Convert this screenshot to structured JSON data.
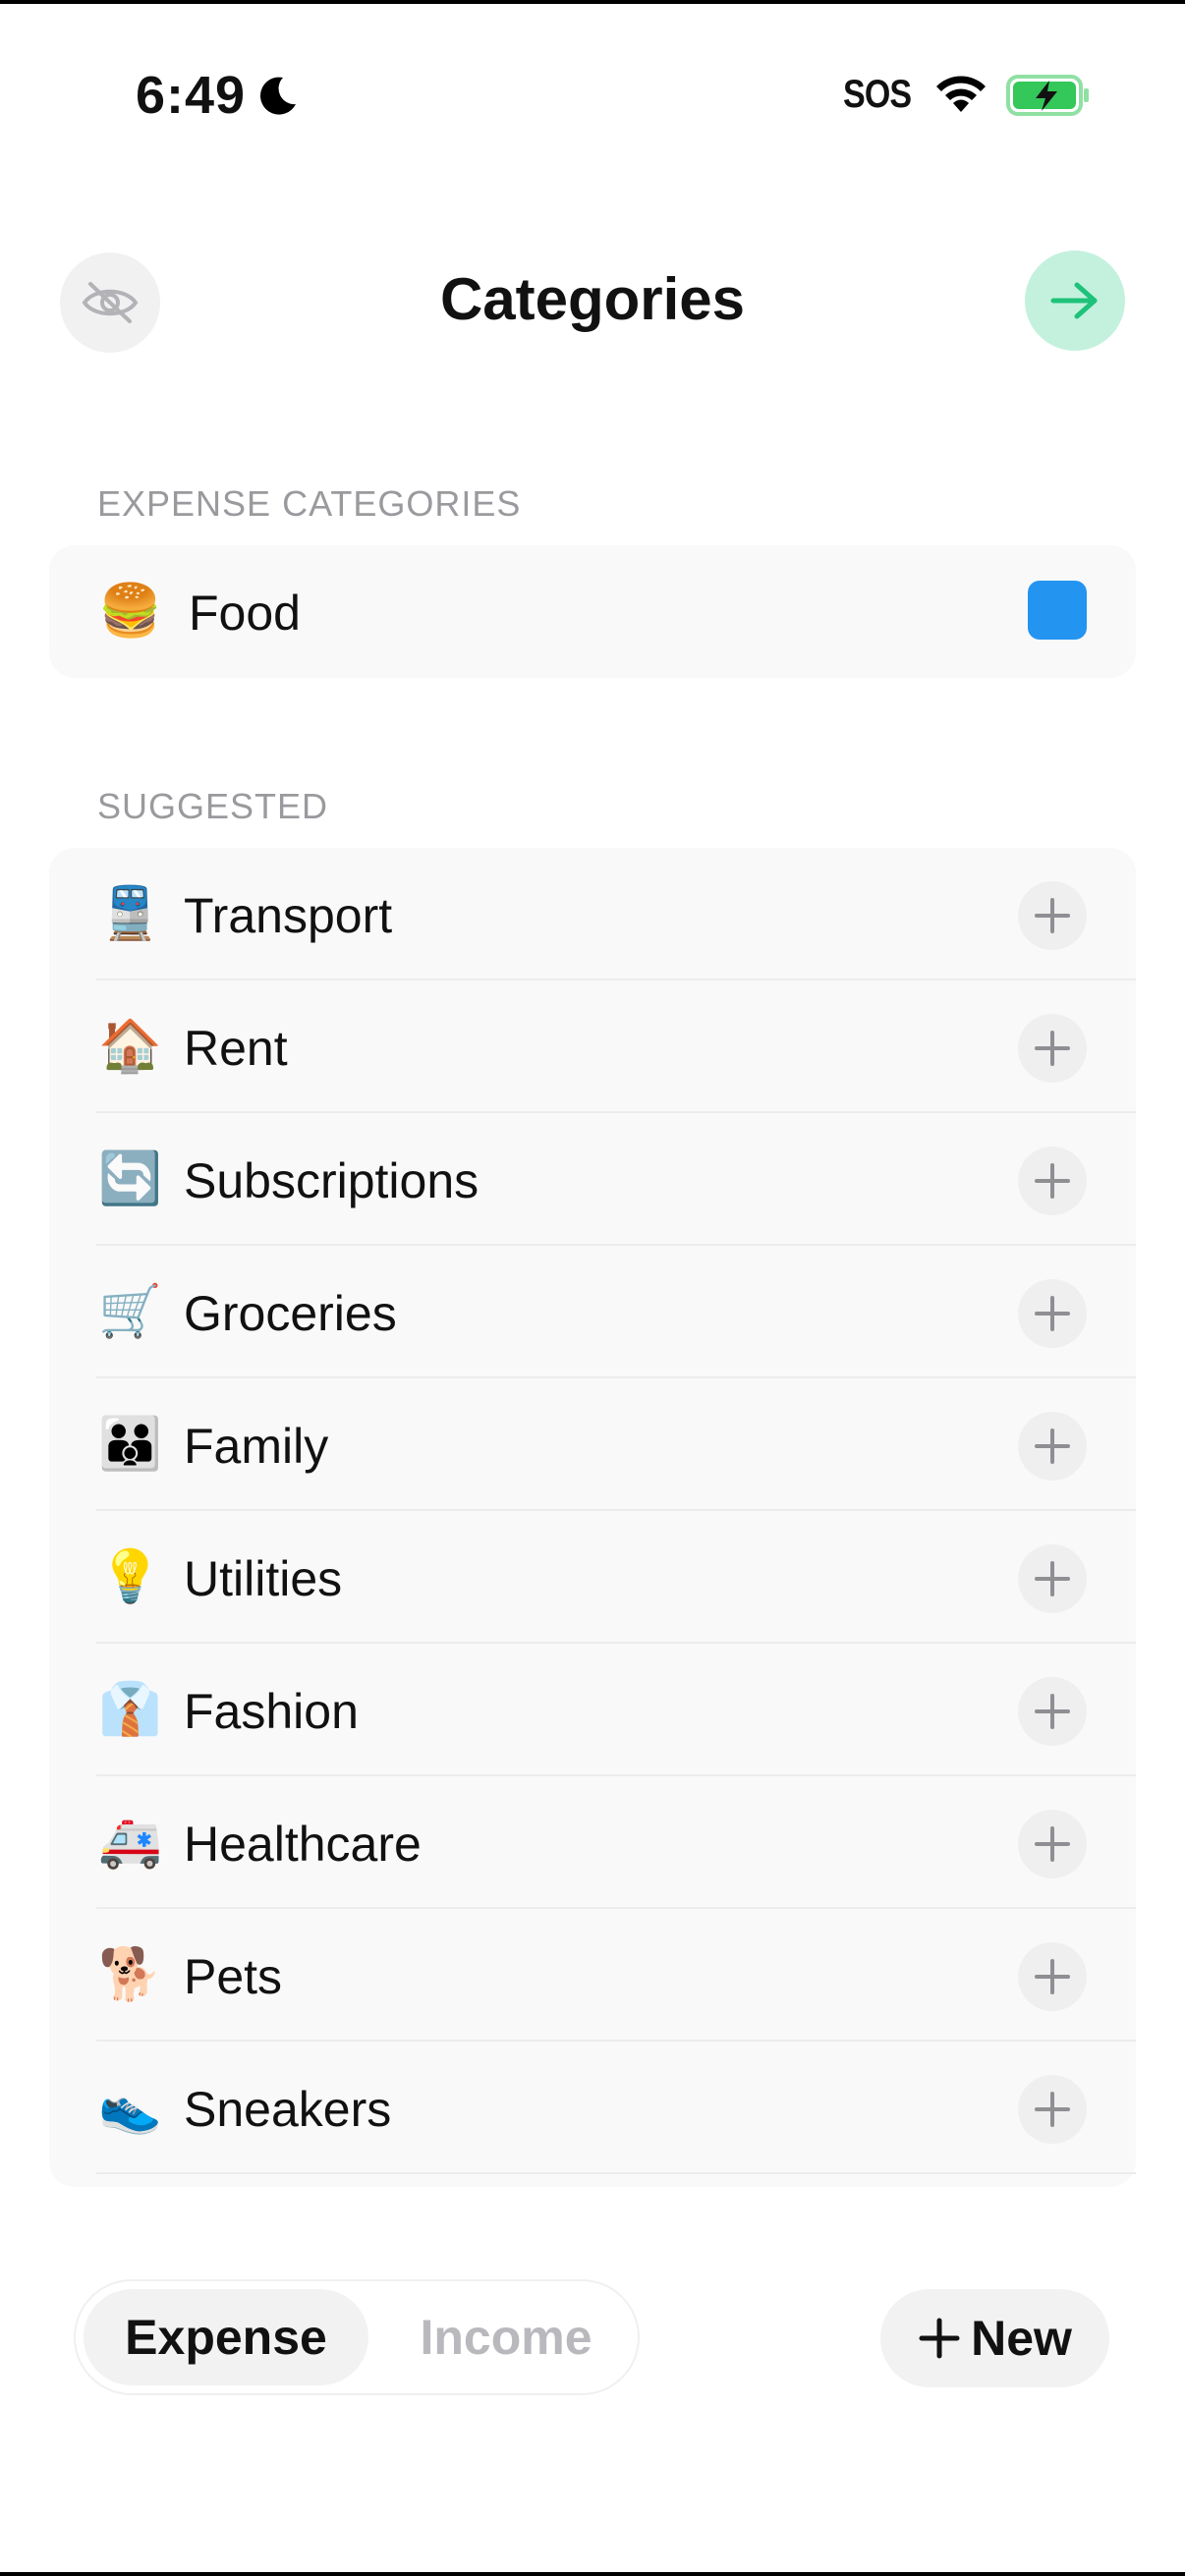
{
  "status_bar": {
    "time": "6:49",
    "sos": "SOS",
    "icons": [
      "moon-icon",
      "wifi-icon",
      "battery-charging-icon"
    ],
    "battery_color": "#34c759"
  },
  "header": {
    "title": "Categories",
    "left_icon": "eye-slash-icon",
    "right_icon": "arrow-right-icon",
    "accent": "#1ec27a"
  },
  "expense_section": {
    "heading": "EXPENSE CATEGORIES",
    "items": [
      {
        "emoji": "🍔",
        "label": "Food",
        "color": "#2394f0"
      }
    ]
  },
  "suggested_section": {
    "heading": "SUGGESTED",
    "items": [
      {
        "emoji": "🚆",
        "label": "Transport"
      },
      {
        "emoji": "🏠",
        "label": "Rent"
      },
      {
        "emoji": "🔄",
        "label": "Subscriptions"
      },
      {
        "emoji": "🛒",
        "label": "Groceries"
      },
      {
        "emoji": "👪",
        "label": "Family"
      },
      {
        "emoji": "💡",
        "label": "Utilities"
      },
      {
        "emoji": "👔",
        "label": "Fashion"
      },
      {
        "emoji": "🚑",
        "label": "Healthcare"
      },
      {
        "emoji": "🐕",
        "label": "Pets"
      },
      {
        "emoji": "👟",
        "label": "Sneakers"
      }
    ]
  },
  "bottom_bar": {
    "tabs": [
      {
        "label": "Expense",
        "selected": true
      },
      {
        "label": "Income",
        "selected": false
      }
    ],
    "new_button": {
      "icon": "plus-icon",
      "label": "New"
    }
  }
}
